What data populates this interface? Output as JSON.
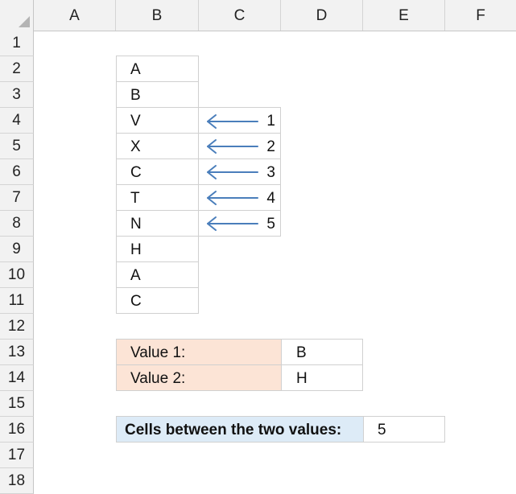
{
  "columns": [
    "A",
    "B",
    "C",
    "D",
    "E",
    "F"
  ],
  "rows": [
    "1",
    "2",
    "3",
    "4",
    "5",
    "6",
    "7",
    "8",
    "9",
    "10",
    "11",
    "12",
    "13",
    "14",
    "15",
    "16",
    "17",
    "18"
  ],
  "list_values": [
    "A",
    "B",
    "V",
    "X",
    "C",
    "T",
    "N",
    "H",
    "A",
    "C"
  ],
  "counts": [
    "1",
    "2",
    "3",
    "4",
    "5"
  ],
  "value1": {
    "label": "Value 1:",
    "value": "B"
  },
  "value2": {
    "label": "Value 2:",
    "value": "H"
  },
  "result": {
    "label": "Cells between the two values:",
    "value": "5"
  },
  "colors": {
    "arrow": "#4a7ebb",
    "label_fill": "#fce4d6",
    "result_fill": "#ddebf7",
    "header_fill": "#f2f2f2"
  },
  "icons": {
    "corner": "select-all-triangle-icon",
    "arrow": "left-arrow-icon"
  }
}
